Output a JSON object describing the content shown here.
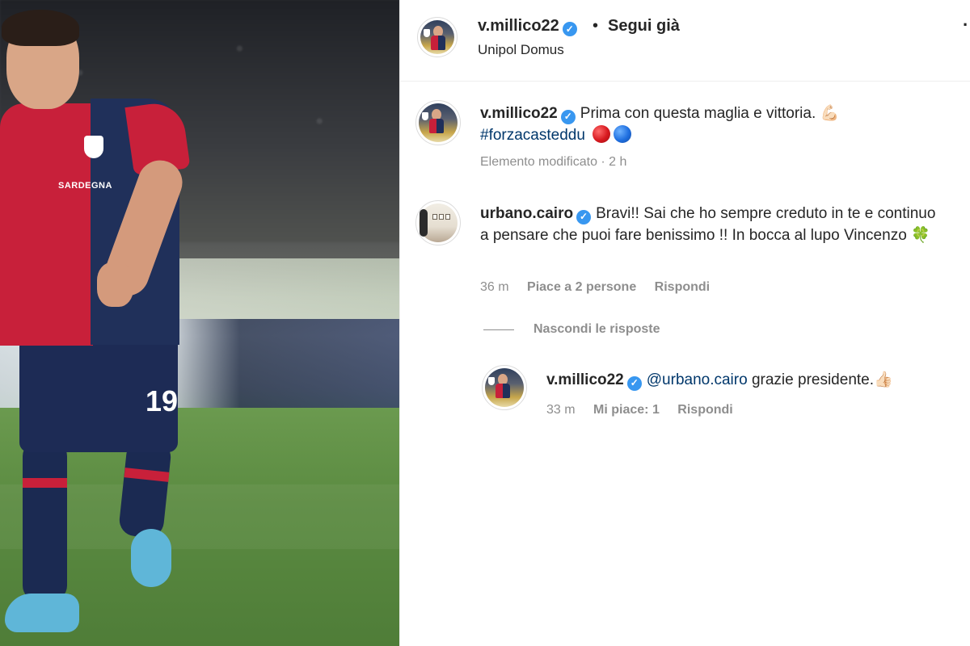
{
  "photo": {
    "jersey_number": "19",
    "sponsor_text": "SARDEGNA"
  },
  "header": {
    "username": "v.millico22",
    "dot": "•",
    "follow_label": "Segui già",
    "location": "Unipol Domus",
    "more_icon": "more-icon"
  },
  "caption": {
    "username": "v.millico22",
    "text": "Prima con questa maglia e vittoria. 💪🏻",
    "hashtag": "#forzacasteddu",
    "meta": "Elemento modificato · 2 h"
  },
  "comment": {
    "username": "urbano.cairo",
    "text": "Bravi!! Sai che ho sempre creduto in te e continuo a pensare che puoi fare benissimo !! In bocca al lupo Vincenzo 🍀",
    "time": "36 m",
    "likes": "Piace a 2 persone",
    "reply_label": "Rispondi"
  },
  "hide_replies_label": "Nascondi le risposte",
  "reply": {
    "username": "v.millico22",
    "mention": "@urbano.cairo",
    "text": "grazie presidente.👍🏻",
    "time": "33 m",
    "likes": "Mi piace: 1",
    "reply_label": "Rispondi"
  },
  "colors": {
    "verified": "#3897f0",
    "muted": "#8e8e8e",
    "link": "#00376b"
  }
}
